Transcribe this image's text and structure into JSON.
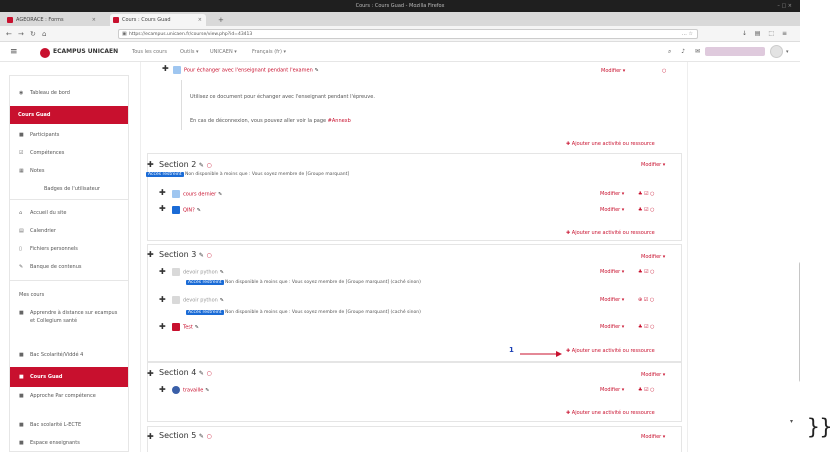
{
  "window": {
    "title": "Cours : Cours Guad - Mozilla Firefox",
    "controls": "– □ ×"
  },
  "tabs": [
    {
      "label": "AGEORACE : Forms",
      "fav_color": "#c8102e",
      "close": "×"
    },
    {
      "label": "Cours : Cours Guad",
      "fav_color": "#c8102e",
      "close": "×"
    }
  ],
  "newtab": "+",
  "nav": {
    "back": "←",
    "forward": "→",
    "reload": "↻",
    "home": "⌂",
    "url": "https://ecampus.unicaen.fr/course/view.php?id=43413",
    "url_icons": "… ☆",
    "toolbar_icons": "↓ ▤ ⬚ ≡"
  },
  "moodle_header": {
    "brand": "ECAMPUS UNICAEN",
    "menus": [
      "Tous les cours",
      "Outils ▾",
      "UNICAEN ▾",
      "Français (fr) ▾"
    ],
    "icons": "⌕ ♪ ✉",
    "avatar_caret": "▾"
  },
  "sidebar": {
    "items": [
      {
        "label": "Tableau de bord",
        "icon": "◉"
      },
      {
        "label": "Cours Guad",
        "icon": ""
      },
      {
        "label": "Participants",
        "icon": "■"
      },
      {
        "label": "Compétences",
        "icon": "☑"
      },
      {
        "label": "Notes",
        "icon": "▦"
      },
      {
        "label": "Badges de l'utilisateur",
        "icon": ""
      },
      {
        "label": "Accueil du site",
        "icon": "⌂"
      },
      {
        "label": "Calendrier",
        "icon": "▤"
      },
      {
        "label": "Fichiers personnels",
        "icon": "▯"
      },
      {
        "label": "Banque de contenus",
        "icon": "✎"
      },
      {
        "label": "Mes cours",
        "icon": ""
      },
      {
        "label": "Apprendre à distance sur ecampus et Collegium santé",
        "icon": "■"
      },
      {
        "label": "Bac Scolarité/Viddé 4",
        "icon": "■"
      },
      {
        "label": "Cours Guad",
        "icon": "■"
      },
      {
        "label": "Approche Par compétence",
        "icon": "■"
      },
      {
        "label": "Bac scolarité L-ECTE",
        "icon": "■"
      },
      {
        "label": "Espace enseignants",
        "icon": "■"
      }
    ]
  },
  "content": {
    "top_activity": {
      "move": "✚",
      "label": "Pour échanger avec l'enseignant pendant l'examen",
      "edit": "✎",
      "modify": "Modifier ▾",
      "icon_right": "○",
      "desc1": "Utilisez ce document pour échanger avec l'enseignant pendant l'épreuve.",
      "desc2": "En cas de déconnexion, vous pouvez aller voir la page ",
      "desc2_link": "#Annexb",
      "add": "✚  Ajouter une activité ou ressource"
    },
    "sections": [
      {
        "title": "Section 2",
        "pen": "✎",
        "eye": "○",
        "modify": "Modifier ▾",
        "badge": "Accès restreint",
        "restriction": "Non disponible à moins que : Vous soyez membre de [Groupe marquant]",
        "activities": [
          {
            "name": "cours dernier",
            "icon_color": "#9fc6f0",
            "edit": "✎",
            "modify": "Modifier ▾",
            "icons": "♣ ☑ ○"
          },
          {
            "name": "QIN?",
            "icon_color": "#1a6bd6",
            "edit": "✎",
            "modify": "Modifier ▾",
            "icons": "♣ ☑ ○"
          }
        ],
        "add": "✚  Ajouter une activité ou ressource"
      },
      {
        "title": "Section 3",
        "pen": "✎",
        "eye": "○",
        "modify": "Modifier ▾",
        "activities": [
          {
            "name": "devoir python",
            "icon_color": "#d9d9d9",
            "edit": "✎",
            "modify": "Modifier ▾",
            "icons": "♣ ☑ ○",
            "grey": true
          },
          {
            "name": "devoir python",
            "icon_color": "#d9d9d9",
            "edit": "✎",
            "modify": "Modifier ▾",
            "icons": "⊕ ☑ ○",
            "grey": true,
            "badge": "Accès restreint",
            "restriction": "Non disponible à moins que : Vous soyez membre de [Groupe marquant] (caché sinon)"
          },
          {
            "name": "Test",
            "icon_color": "#c8102e",
            "edit": "✎",
            "modify": "Modifier ▾",
            "icons": "♣ ☑ ○",
            "badge": "Accès restreint",
            "restriction": "Non disponible à moins que : Vous soyez membre de [Groupe marquant] (caché sinon)"
          }
        ],
        "annotation": "1",
        "add": "✚  Ajouter une activité ou ressource"
      },
      {
        "title": "Section 4",
        "pen": "✎",
        "eye": "○",
        "modify": "Modifier ▾",
        "activities": [
          {
            "name": "travaille",
            "icon_color": "#3a5fa8",
            "edit": "✎",
            "modify": "Modifier ▾",
            "icons": "♣ ☑ ○"
          }
        ],
        "add": "✚  Ajouter une activité ou ressource"
      },
      {
        "title": "Section 5",
        "pen": "✎",
        "eye": "○",
        "modify": "Modifier ▾"
      }
    ]
  },
  "page_tail": "}}"
}
